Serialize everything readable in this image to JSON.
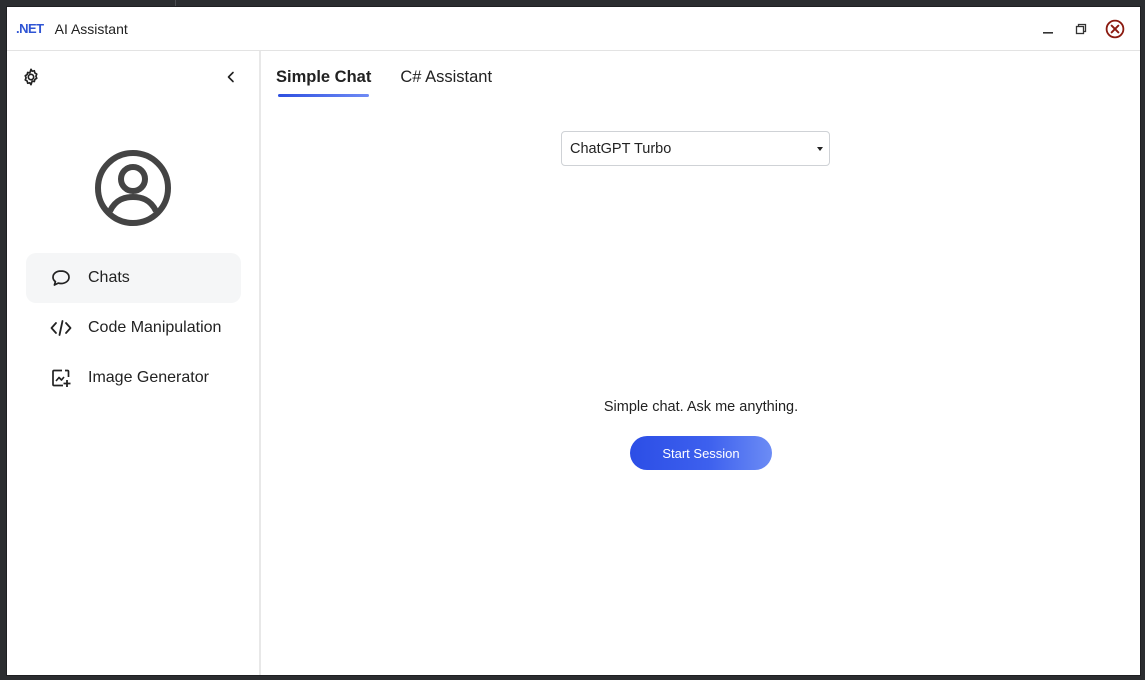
{
  "app": {
    "logo_text": ".NET",
    "title": "AI Assistant",
    "brand_color": "#2f55d4"
  },
  "window_controls": {
    "minimize_icon": "minimize-icon",
    "restore_icon": "restore-icon",
    "close_icon": "close-icon",
    "close_color": "#8b1a10"
  },
  "sidebar": {
    "settings_icon": "gear-icon",
    "collapse_icon": "chevron-left-icon",
    "avatar_icon": "user-circle-icon",
    "items": [
      {
        "label": "Chats",
        "icon": "chat-bubble-icon",
        "active": true
      },
      {
        "label": "Code Manipulation",
        "icon": "code-icon",
        "active": false
      },
      {
        "label": "Image Generator",
        "icon": "image-add-icon",
        "active": false
      }
    ]
  },
  "main": {
    "tabs": [
      {
        "label": "Simple Chat",
        "active": true
      },
      {
        "label": "C# Assistant",
        "active": false
      }
    ],
    "model_select": {
      "value": "ChatGPT Turbo"
    },
    "hint_text": "Simple chat. Ask me anything.",
    "start_button_label": "Start Session",
    "accent_color": "#2c4ee6"
  }
}
